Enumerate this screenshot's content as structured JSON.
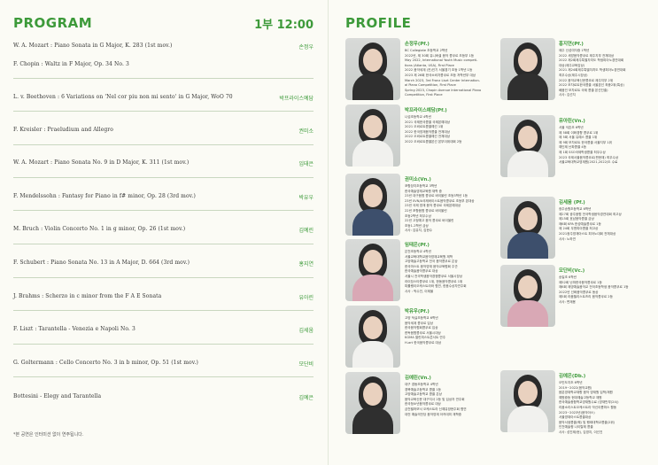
{
  "program": {
    "title": "PROGRAM",
    "time": "1부 12:00",
    "note": "*본 공연은 인터미션 없이 연주됩니다.",
    "items": [
      {
        "piece": "W. A. Mozart : Piano Sonata in G Major, K. 283 (1st mov.)",
        "performer": "손정우"
      },
      {
        "piece": "F. Chopin : Waltz in F Major, Op. 34 No. 3",
        "performer": ""
      },
      {
        "piece": "L. v. Beethoven : 6 Variations on 'Nel cor piu non mi sento' in G Major, WoO 70",
        "performer": "박프라이스예담"
      },
      {
        "piece": "F. Kreisler : Praeludium and Allegro",
        "performer": "권미소"
      },
      {
        "piece": "W. A. Mozart : Piano Sonata No. 9 in D Major, K. 311 (1st mov.)",
        "performer": "임태은"
      },
      {
        "piece": "F. Mendelssohn : Fantasy for Piano in f# minor, Op. 28 (3rd mov.)",
        "performer": "박유우"
      },
      {
        "piece": "M. Bruch : Violin Concerto No. 1 in g minor, Op. 26 (1st mov.)",
        "performer": "김예린"
      },
      {
        "piece": "F. Schubert : Piano Sonata No. 13 in A Major, D. 664 (3rd mov.)",
        "performer": "홍지연"
      },
      {
        "piece": "J. Brahms : Scherzo in c minor from the F A E Sonata",
        "performer": "유아린"
      },
      {
        "piece": "F. Liszt : Tarantella - Venezia e Napoli No. 3",
        "performer": "김세움"
      },
      {
        "piece": "G. Goltermann : Cello Concerto No. 3 in b minor, Op. 51 (1st mov.)",
        "performer": "모단비"
      },
      {
        "piece": "Bottesini - Elegy and Tarantella",
        "performer": "김예은"
      }
    ]
  },
  "profile": {
    "title": "PROFILE",
    "left": [
      {
        "name": "손정우(Pf.)",
        "lines": [
          "BC Collegiate 초등학교 2학년",
          "2022년, 제 30회 유니버셜 음악 콩쿠르 초등부 1등",
          "May 2022, International Youth Music competi-",
          "tions (Atlanta, USA), First Place",
          "2022 음악세계 (전)인기 서울경기 초등 1학년 1등",
          "2023 제 26회 한국소비자콩쿠르 초등 저학년부 대상",
          "March 2023, 3rd Franz Liszt Center Internation-",
          "al Piano Competition, First Place",
          "Spring 2023, Chopin Avenue International Piano",
          "Competition, First Place"
        ]
      },
      {
        "name": "박프라이스예담(Pf.)",
        "lines": [
          "나섬초등학교 4학년",
          "2021 국제한국콩쿨 국제본예대상",
          "2021 오비르트콩쿨예선 1위",
          "2022 한국영재음악콩쿨 전체대상",
          "2022 오비르트콩쿨예선 전체대상",
          "2022 오비르트콩쿨본선 본부이위대회 2등"
        ]
      },
      {
        "name": "권미소(Vn.)",
        "lines": [
          "포항장지초등학교 3학년",
          "한국예술영재교육원 재학 중",
          "23년 대구음협 콩쿠르 바이올린 초등3학년 1등",
          "23년 0VN/A국제바이스트음악콩쿠르 초등부 본대상",
          "23년 국제 영재 음악 콩쿠르 국제본예대상",
          "22년 포항음협 콩쿠르 바이올린",
          "초등2학년 최우수상",
          "22년 고정예고 음악 콩쿠르 바이올린",
          "초등1-2학년 금상",
          "사사: 김유지, 김현수"
        ]
      },
      {
        "name": "임태은(Pf.)",
        "lines": [
          "은천초등학교 4학년",
          "서울교육대학교음악영재교육원 재학",
          "고양예술고등학교 전국 음악콩쿠르 은상",
          "한국마스트 음악영재 음악교육협회 주관",
          "한국예술음악콩쿠르 대상",
          "서울시 전국학생음악경쟁콩쿠르 서울시장상",
          "라이징스타콩쿠르 1위, 한동음악콩쿠르 1위",
          "피를랭이오케스트라와 협연, 한음수상자연주회",
          "사사 : 박수진, 이제율"
        ]
      },
      {
        "name": "박유우(Pf.)",
        "lines": [
          "고양 덕실초등학교 6학년",
          "음악세계 콩쿠르 입상",
          "한국음악협회콩쿠르 입상",
          "한독음협콩쿠르 서울시대상",
          "KGMA 열린피스트콘서트 연주",
          "H-art 한국음악콩쿠르 대상"
        ]
      },
      {
        "name": "김예린(Vn.)",
        "lines": [
          "대구 경동초등학교 4학년",
          "경북예술고등학교 콩쿨 1등",
          "고양예술고등학교 콩쿨 은상",
          "음악교육신문 대구지사 2등 및 입상자 연주회",
          "한국청소년음악콩쿠르 대상",
          "금천필하모닉 오케스트라 신예유망현주회 협연",
          "대전 예술의전당 음악영재 아카데미 재학중"
        ]
      }
    ],
    "right": [
      {
        "name": "홍지연(Pf.)",
        "lines": [
          "제주 신성여자중 1학년",
          "2022 세방음악콩쿠르 제주지부 전체대상",
          "2022 제2회제주특별자치도 학생피아노경연대회",
          "대상(제주교육감상)",
          "2021 제24회제주특별자치도 학생피아노경연대회",
          "최우수상(제주시장상)",
          "2022 음악교육신문콩쿠르 제주지부 2위",
          "2022 모차르트한국콩쿨 서울본선 최종2위(특상)",
          "배움인 모차르트 국제 콩쿨 본선진출)",
          "사사: 김선지"
        ]
      },
      {
        "name": "유아린(Vn.)",
        "lines": [
          "서울 석촌초 6학년",
          "제 58회 이화경향 콩쿠르 1위",
          "제 5회 서울 유예스 콩쿨 1위",
          "제 9회 모차르트 한국콩쿨 서울지부 1위",
          "예인제 난파콩쿨 4등",
          "제 1회 SSO국제학생콩쿨 최우수상",
          "2023 국제서울음악콩쿠르(판현재) 최우수상",
          "서울교육대학교영재원(2021,2022)도 수료"
        ]
      },
      {
        "name": "김세움 (Pf.)",
        "lines": [
          "광주송원초등학교 6학년",
          "제27회 광주음협 전국학생음악경연대회 최고상",
          "제15회 호남음악콩쿨 금상",
          "제6회 KPA 한성예술콩쿠르 1등",
          "제 24회 우엔피아콩쿨 최고상",
          "2021광주영재아스트 피아노대회 전체대상",
          "사사: 노하연"
        ]
      },
      {
        "name": "모단비(Vc.)",
        "lines": [
          "송일초 6학년",
          "제52회 난파한국음악콩쿠르 1등",
          "제6회 제영예술음악교 전국초등학생 음악콩쿠르 1등",
          "2022년 선화음악콩쿠르 동상",
          "제5회 라움첼리스트즈리 음악콩쿠르 2등",
          "사사: 변재용"
        ]
      },
      {
        "name": "김예은(Db.)",
        "lines": [
          "오민도지초 6학년",
          "2019~2022(음악교원)",
          "음분영재학교재향 음악 영재원 입학/재원",
          "예원중등 현대예술고등학교 재원",
          "한국예술종합학교영재원수료 (영재반부(24))",
          "리움소리스트오케스트라 악신이름마스 활동",
          "2023~2023년(음악아스)",
          "서울영재아스트콩쿨대상",
          "음악서생콩쿨(퀘) 및 행태대학교콩쿨(2위)",
          "인천예술평 나이탈레 콩쿨",
          "사사: 성진제(현), 김영지, 이선진"
        ]
      }
    ]
  }
}
